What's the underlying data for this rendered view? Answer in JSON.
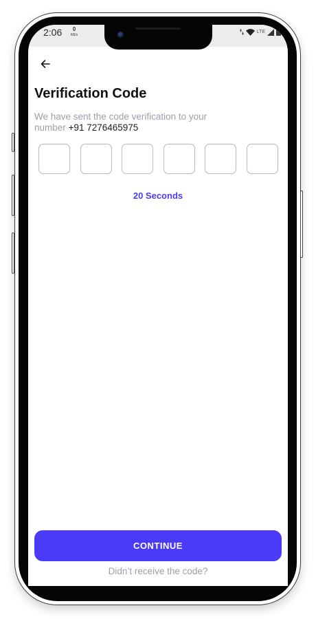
{
  "status_bar": {
    "time": "2:06",
    "net_speed_value": "0",
    "net_speed_unit": "KB/s",
    "network_label": "LTE",
    "icons": [
      "data-arrows-icon",
      "wifi-icon",
      "lte-icon",
      "cell-signal-icon",
      "battery-icon"
    ]
  },
  "header": {
    "back_icon": "arrow-left-icon",
    "title": "Verification Code"
  },
  "verification": {
    "message": "We have sent the code verification to your number",
    "phone_number": "+91 7276465975",
    "otp_digits": [
      "",
      "",
      "",
      "",
      "",
      ""
    ],
    "timer_text": "20 Seconds"
  },
  "actions": {
    "continue_label": "CONTINUE",
    "resend_label": "Didn’t receive the code?"
  },
  "colors": {
    "accent": "#4a3bf8",
    "muted_text": "#9aa0aa",
    "title_text": "#111111",
    "otp_border": "#b7b7bd"
  }
}
